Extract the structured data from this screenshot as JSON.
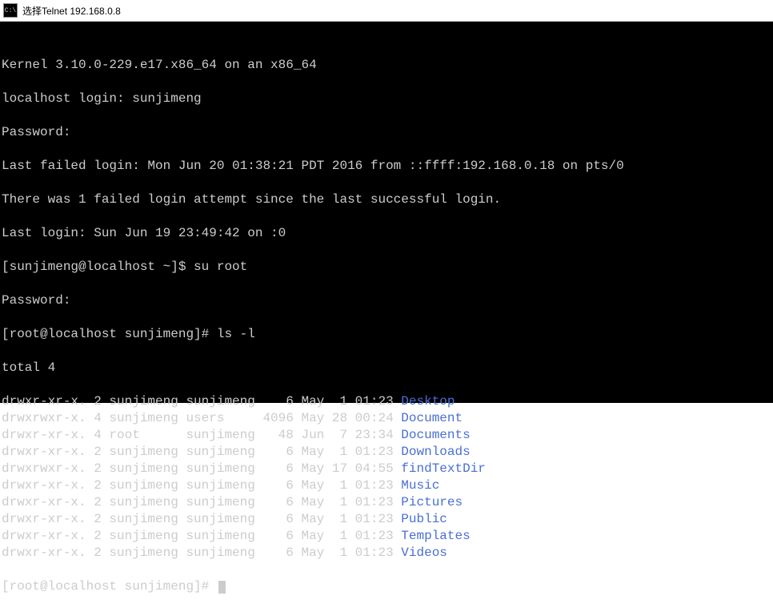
{
  "title": "选择Telnet 192.168.0.8",
  "icon_label": "C:\\",
  "terminal": {
    "blank_top": "",
    "kernel": "Kernel 3.10.0-229.e17.x86_64 on an x86_64",
    "login_prompt": "localhost login: sunjimeng",
    "password1": "Password:",
    "last_failed": "Last failed login: Mon Jun 20 01:38:21 PDT 2016 from ::ffff:192.168.0.18 on pts/0",
    "failed_attempt": "There was 1 failed login attempt since the last successful login.",
    "last_login": "Last login: Sun Jun 19 23:49:42 on :0",
    "prompt1_a": "[sunjimeng@localhost ~]$ ",
    "prompt1_cmd": "su root",
    "password2": "Password:",
    "prompt2_a": "[root@localhost sunjimeng]# ",
    "prompt2_cmd": "ls -l",
    "total": "total 4",
    "rows": [
      {
        "meta": "drwxr-xr-x. 2 sunjimeng sunjimeng    6 May  1 01:23 ",
        "name": "Desktop"
      },
      {
        "meta": "drwxrwxr-x. 4 sunjimeng users     4096 May 28 00:24 ",
        "name": "Document"
      },
      {
        "meta": "drwxr-xr-x. 4 root      sunjimeng   48 Jun  7 23:34 ",
        "name": "Documents"
      },
      {
        "meta": "drwxr-xr-x. 2 sunjimeng sunjimeng    6 May  1 01:23 ",
        "name": "Downloads"
      },
      {
        "meta": "drwxrwxr-x. 2 sunjimeng sunjimeng    6 May 17 04:55 ",
        "name": "findTextDir"
      },
      {
        "meta": "drwxr-xr-x. 2 sunjimeng sunjimeng    6 May  1 01:23 ",
        "name": "Music"
      },
      {
        "meta": "drwxr-xr-x. 2 sunjimeng sunjimeng    6 May  1 01:23 ",
        "name": "Pictures"
      },
      {
        "meta": "drwxr-xr-x. 2 sunjimeng sunjimeng    6 May  1 01:23 ",
        "name": "Public"
      },
      {
        "meta": "drwxr-xr-x. 2 sunjimeng sunjimeng    6 May  1 01:23 ",
        "name": "Templates"
      },
      {
        "meta": "drwxr-xr-x. 2 sunjimeng sunjimeng    6 May  1 01:23 ",
        "name": "Videos"
      }
    ],
    "prompt3": "[root@localhost sunjimeng]# "
  }
}
